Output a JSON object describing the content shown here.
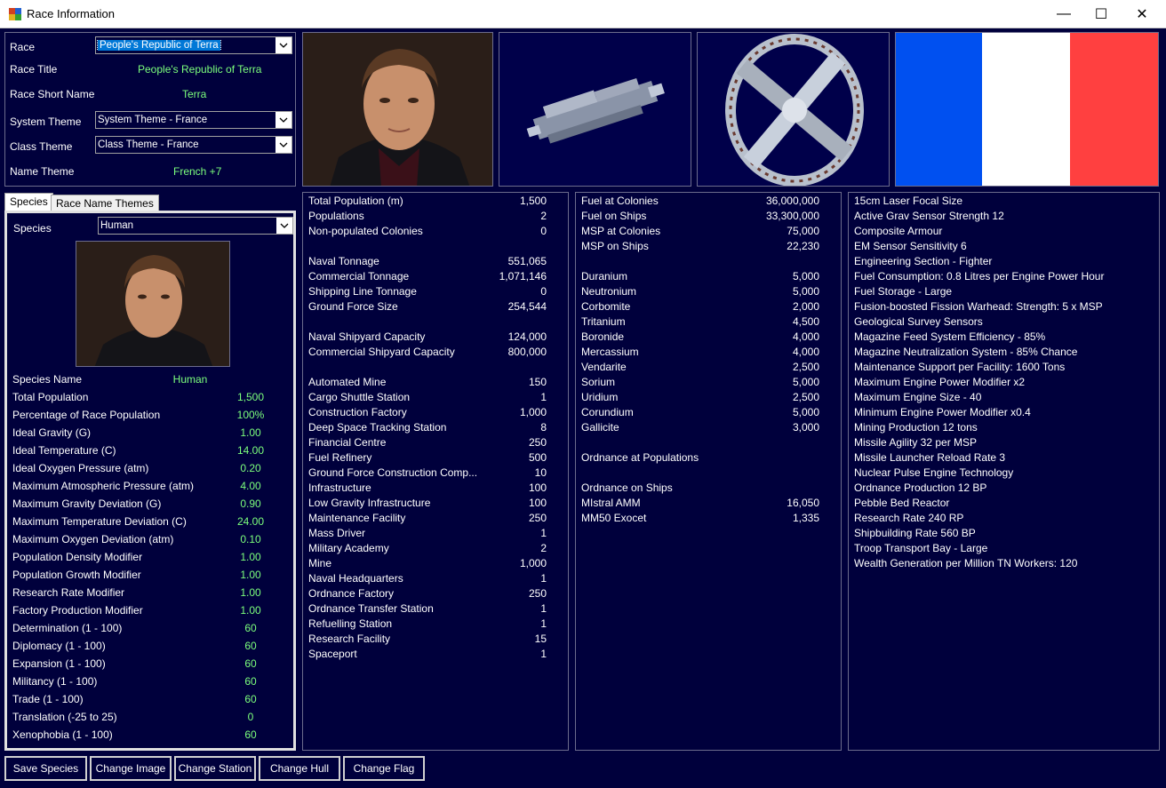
{
  "window": {
    "title": "Race Information",
    "minimize": "—",
    "maximize": "☐",
    "close": "✕"
  },
  "race_panel": {
    "race_label": "Race",
    "race_value": "People's Republic of Terra",
    "race_title_label": "Race Title",
    "race_title_value": "People's Republic of Terra",
    "short_name_label": "Race Short Name",
    "short_name_value": "Terra",
    "system_theme_label": "System Theme",
    "system_theme_value": "System Theme - France",
    "class_theme_label": "Class Theme",
    "class_theme_value": "Class Theme - France",
    "name_theme_label": "Name Theme",
    "name_theme_value": "French +7"
  },
  "tabs": {
    "species": "Species",
    "race_name_themes": "Race Name Themes"
  },
  "species_panel": {
    "species_label": "Species",
    "species_value": "Human",
    "rows": [
      {
        "label": "Species Name",
        "value": "Human"
      },
      {
        "label": "Total Population",
        "value": "1,500"
      },
      {
        "label": "Percentage of Race Population",
        "value": "100%"
      },
      {
        "label": "Ideal Gravity (G)",
        "value": "1.00"
      },
      {
        "label": "Ideal Temperature (C)",
        "value": "14.00"
      },
      {
        "label": "Ideal Oxygen Pressure (atm)",
        "value": "0.20"
      },
      {
        "label": "Maximum Atmospheric Pressure (atm)",
        "value": "4.00"
      },
      {
        "label": "Maximum Gravity Deviation (G)",
        "value": "0.90"
      },
      {
        "label": "Maximum Temperature Deviation (C)",
        "value": "24.00"
      },
      {
        "label": "Maximum Oxygen Deviation (atm)",
        "value": "0.10"
      },
      {
        "label": "Population Density Modifier",
        "value": "1.00"
      },
      {
        "label": "Population Growth Modifier",
        "value": "1.00"
      },
      {
        "label": "Research Rate Modifier",
        "value": "1.00"
      },
      {
        "label": "Factory Production Modifier",
        "value": "1.00"
      },
      {
        "label": "Determination (1 - 100)",
        "value": "60"
      },
      {
        "label": "Diplomacy (1 - 100)",
        "value": "60"
      },
      {
        "label": "Expansion (1 - 100)",
        "value": "60"
      },
      {
        "label": "Militancy (1 - 100)",
        "value": "60"
      },
      {
        "label": "Trade (1 - 100)",
        "value": "60"
      },
      {
        "label": "Translation (-25 to 25)",
        "value": "0"
      },
      {
        "label": "Xenophobia (1 - 100)",
        "value": "60"
      }
    ]
  },
  "population_list": [
    {
      "label": "Total Population (m)",
      "value": "1,500"
    },
    {
      "label": "Populations",
      "value": "2"
    },
    {
      "label": "Non-populated Colonies",
      "value": "0"
    },
    {
      "label": "",
      "value": ""
    },
    {
      "label": "Naval Tonnage",
      "value": "551,065"
    },
    {
      "label": "Commercial Tonnage",
      "value": "1,071,146"
    },
    {
      "label": "Shipping Line Tonnage",
      "value": "0"
    },
    {
      "label": "Ground Force Size",
      "value": "254,544"
    },
    {
      "label": "",
      "value": ""
    },
    {
      "label": "Naval Shipyard Capacity",
      "value": "124,000"
    },
    {
      "label": "Commercial Shipyard Capacity",
      "value": "800,000"
    },
    {
      "label": "",
      "value": ""
    },
    {
      "label": "Automated Mine",
      "value": "150"
    },
    {
      "label": "Cargo Shuttle Station",
      "value": "1"
    },
    {
      "label": "Construction Factory",
      "value": "1,000"
    },
    {
      "label": "Deep Space Tracking Station",
      "value": "8"
    },
    {
      "label": "Financial Centre",
      "value": "250"
    },
    {
      "label": "Fuel Refinery",
      "value": "500"
    },
    {
      "label": "Ground Force Construction Comp...",
      "value": "10"
    },
    {
      "label": "Infrastructure",
      "value": "100"
    },
    {
      "label": "Low Gravity Infrastructure",
      "value": "100"
    },
    {
      "label": "Maintenance Facility",
      "value": "250"
    },
    {
      "label": "Mass Driver",
      "value": "1"
    },
    {
      "label": "Military Academy",
      "value": "2"
    },
    {
      "label": "Mine",
      "value": "1,000"
    },
    {
      "label": "Naval Headquarters",
      "value": "1"
    },
    {
      "label": "Ordnance Factory",
      "value": "250"
    },
    {
      "label": "Ordnance Transfer Station",
      "value": "1"
    },
    {
      "label": "Refuelling Station",
      "value": "1"
    },
    {
      "label": "Research Facility",
      "value": "15"
    },
    {
      "label": "Spaceport",
      "value": "1"
    }
  ],
  "resources_list": [
    {
      "label": "Fuel at Colonies",
      "value": "36,000,000"
    },
    {
      "label": "Fuel on Ships",
      "value": "33,300,000"
    },
    {
      "label": "MSP at Colonies",
      "value": "75,000"
    },
    {
      "label": "MSP on Ships",
      "value": "22,230"
    },
    {
      "label": "",
      "value": ""
    },
    {
      "label": "Duranium",
      "value": "5,000"
    },
    {
      "label": "Neutronium",
      "value": "5,000"
    },
    {
      "label": "Corbomite",
      "value": "2,000"
    },
    {
      "label": "Tritanium",
      "value": "4,500"
    },
    {
      "label": "Boronide",
      "value": "4,000"
    },
    {
      "label": "Mercassium",
      "value": "4,000"
    },
    {
      "label": "Vendarite",
      "value": "2,500"
    },
    {
      "label": "Sorium",
      "value": "5,000"
    },
    {
      "label": "Uridium",
      "value": "2,500"
    },
    {
      "label": "Corundium",
      "value": "5,000"
    },
    {
      "label": "Gallicite",
      "value": "3,000"
    },
    {
      "label": "",
      "value": ""
    },
    {
      "label": "Ordnance at Populations",
      "value": ""
    },
    {
      "label": "",
      "value": ""
    },
    {
      "label": "Ordnance on Ships",
      "value": ""
    },
    {
      "label": "MIstral AMM",
      "value": "16,050"
    },
    {
      "label": "MM50 Exocet",
      "value": "1,335"
    }
  ],
  "tech_list": [
    "15cm Laser Focal Size",
    "Active Grav Sensor Strength 12",
    "Composite Armour",
    "EM Sensor Sensitivity 6",
    "Engineering Section - Fighter",
    "Fuel Consumption: 0.8 Litres per Engine Power Hour",
    "Fuel Storage - Large",
    "Fusion-boosted Fission Warhead: Strength: 5 x MSP",
    "Geological Survey Sensors",
    "Magazine Feed System Efficiency - 85%",
    "Magazine Neutralization System - 85% Chance",
    "Maintenance Support per Facility: 1600 Tons",
    "Maximum Engine Power Modifier x2",
    "Maximum Engine Size - 40",
    "Minimum Engine Power Modifier x0.4",
    "Mining Production 12 tons",
    "Missile Agility 32 per MSP",
    "Missile Launcher Reload Rate 3",
    "Nuclear Pulse Engine Technology",
    "Ordnance Production 12 BP",
    "Pebble Bed Reactor",
    "Research Rate 240 RP",
    "Shipbuilding Rate 560 BP",
    "Troop Transport Bay - Large",
    "Wealth Generation per Million TN Workers: 120"
  ],
  "buttons": {
    "save_species": "Save Species",
    "change_image": "Change Image",
    "change_station": "Change Station",
    "change_hull": "Change Hull",
    "change_flag": "Change Flag"
  },
  "colors": {
    "background": "#00003c",
    "value_green": "#7cff7c",
    "flag_blue": "#0050f0",
    "flag_white": "#ffffff",
    "flag_red": "#ff4040"
  },
  "icons": {
    "app": "app-icon",
    "dropdown": "chevron-down-icon"
  }
}
